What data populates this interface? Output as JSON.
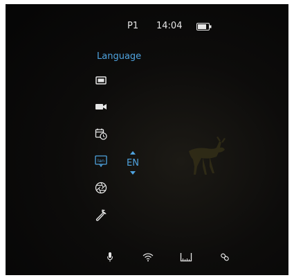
{
  "status": {
    "profile": "P1",
    "time": "14:04",
    "battery_icon": "battery-icon"
  },
  "menu": {
    "title": "Language",
    "items": [
      {
        "icon": "display-icon"
      },
      {
        "icon": "video-camera-icon"
      },
      {
        "icon": "calendar-clock-icon"
      },
      {
        "icon": "language-icon",
        "selected": true
      },
      {
        "icon": "aperture-icon"
      },
      {
        "icon": "wrench-icon"
      }
    ],
    "value": "EN"
  },
  "bottom_bar": {
    "icons": [
      "microphone-icon",
      "wifi-icon",
      "ruler-icon",
      "link-icon"
    ]
  },
  "colors": {
    "accent": "#4fa3df",
    "text": "#e6e6e6",
    "background": "#080807"
  }
}
